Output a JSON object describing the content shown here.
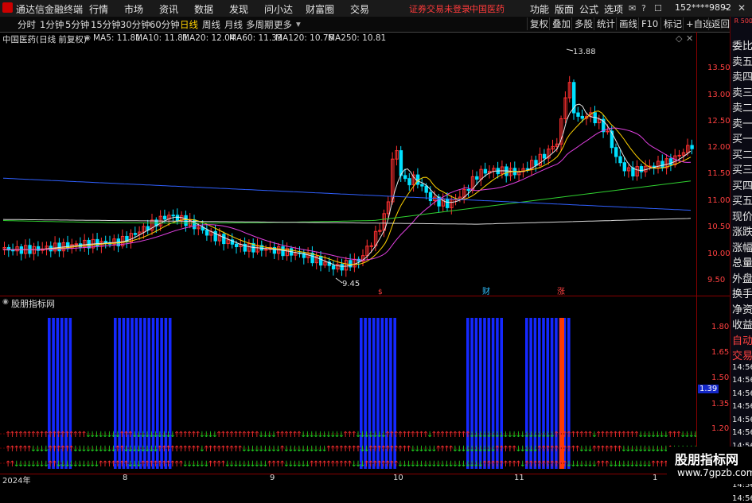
{
  "titlebar": {
    "app_title": "通达信金融终端",
    "menu": [
      "行情",
      "市场",
      "资讯",
      "数据",
      "发现",
      "问小达",
      "财富圈",
      "交易"
    ],
    "warning": "证券交易未登录",
    "stock": "中国医药",
    "right_menu": [
      "功能",
      "版面",
      "公式",
      "选项"
    ],
    "account": "152****9892"
  },
  "toolbar": {
    "periods": [
      "分时",
      "1分钟",
      "5分钟",
      "15分钟",
      "30分钟",
      "60分钟",
      "日线",
      "周线",
      "月线",
      "多周期",
      "更多"
    ],
    "active_period": "日线",
    "right_buttons": [
      "复权",
      "叠加",
      "多股",
      "统计",
      "画线",
      "F10",
      "标记",
      "+自选",
      "返回"
    ]
  },
  "chart_header": {
    "name": "中国医药(日线 前复权)",
    "ma": [
      {
        "label": "MA5: 11.81",
        "color": "#e6e6e6"
      },
      {
        "label": "MA10: 11.81",
        "color": "#ffd200"
      },
      {
        "label": "MA20: 12.04",
        "color": "#e040e0"
      },
      {
        "label": "MA60: 11.33",
        "color": "#30d030"
      },
      {
        "label": "MA120: 10.76",
        "color": "#e6e6e6"
      },
      {
        "label": "MA250: 10.81",
        "color": "#3060ff"
      }
    ]
  },
  "indicator_header": {
    "name": "股朋指标网"
  },
  "price_axis": [
    "13.50",
    "13.00",
    "12.50",
    "12.00",
    "11.50",
    "11.00",
    "10.50",
    "10.00",
    "9.50"
  ],
  "indicator_axis": [
    "1.80",
    "1.65",
    "1.50",
    "1.39",
    "1.35",
    "1.20"
  ],
  "current_indicator_value": "1.39",
  "annotations": {
    "high": "13.88",
    "low": "9.45",
    "markers": [
      "$",
      "财",
      "涨"
    ]
  },
  "date_axis": [
    "2024年",
    "8",
    "9",
    "10",
    "11",
    "1"
  ],
  "side_panel": {
    "top_label": "R 500",
    "items": [
      "委比",
      "卖五",
      "卖四",
      "卖三",
      "卖二",
      "卖一",
      "买一",
      "买二",
      "买三",
      "买四",
      "买五",
      "现价",
      "涨跌",
      "涨幅",
      "总量",
      "外盘",
      "换手",
      "净资",
      "收益",
      "自动",
      "交易",
      "14:56",
      "14:56",
      "14:56",
      "14:56",
      "14:56",
      "14:56",
      "14:56",
      "14:56",
      "14:56",
      "14:56",
      "14:56"
    ]
  },
  "watermark": {
    "line1": "股朋指标网",
    "line2": "www.7gpzb.com"
  },
  "colors": {
    "up": "#ff3030",
    "down": "#00e0ff",
    "ma5": "#e6e6e6",
    "ma10": "#ffd200",
    "ma20": "#e040e0",
    "ma60": "#30d030",
    "ma250": "#3060ff",
    "bar": "#1428ff"
  }
}
